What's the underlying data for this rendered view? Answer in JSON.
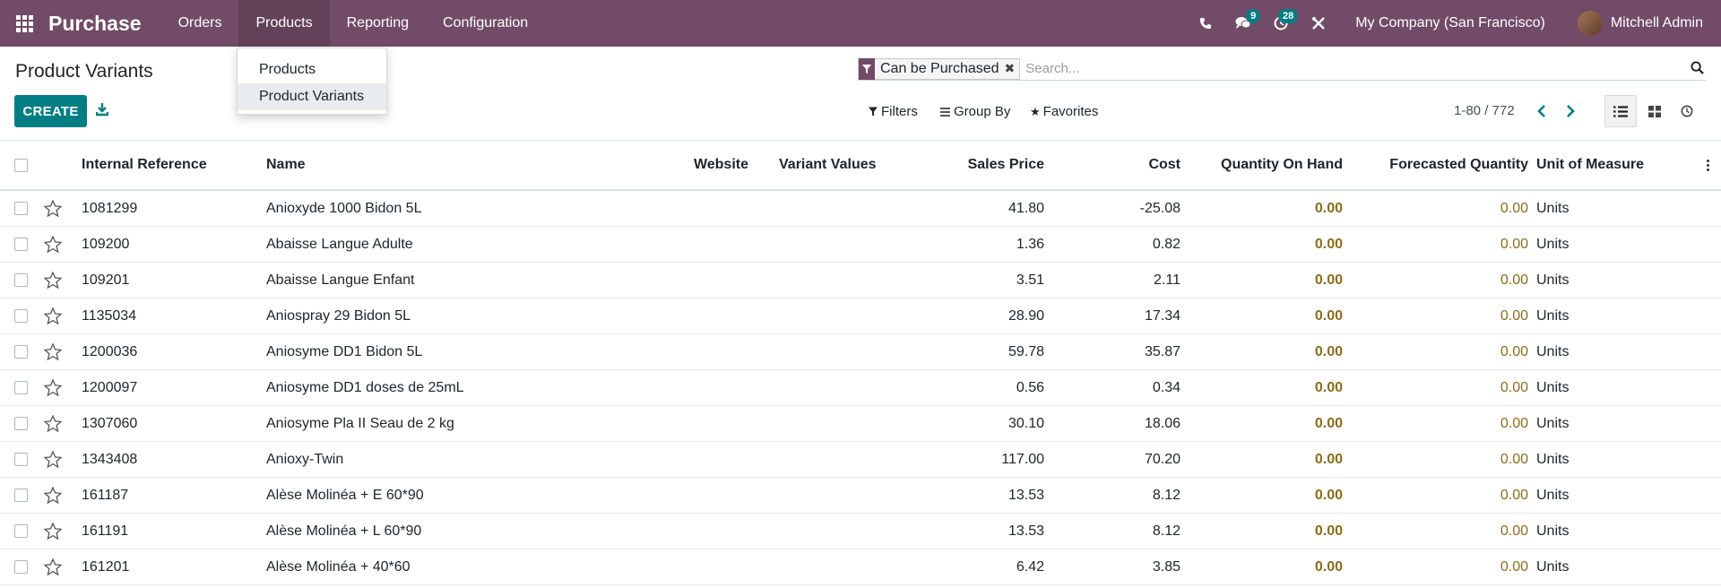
{
  "navbar": {
    "brand": "Purchase",
    "menu": [
      "Orders",
      "Products",
      "Reporting",
      "Configuration"
    ],
    "messages_count": "9",
    "activities_count": "28",
    "company": "My Company (San Francisco)",
    "user": "Mitchell Admin",
    "accent_color": "#714B67"
  },
  "products_menu": {
    "items": [
      "Products",
      "Product Variants"
    ],
    "active": "Product Variants"
  },
  "control_panel": {
    "title": "Product Variants",
    "create_label": "CREATE",
    "facet": "Can be Purchased",
    "search_placeholder": "Search...",
    "filters_label": "Filters",
    "group_by_label": "Group By",
    "favorites_label": "Favorites",
    "pager": "1-80 / 772"
  },
  "table": {
    "headers": {
      "internal_reference": "Internal Reference",
      "name": "Name",
      "website": "Website",
      "variant_values": "Variant Values",
      "sales_price": "Sales Price",
      "cost": "Cost",
      "qty_on_hand": "Quantity On Hand",
      "forecasted_qty": "Forecasted Quantity",
      "uom": "Unit of Measure"
    },
    "rows": [
      {
        "ref": "1081299",
        "name": "Anioxyde 1000 Bidon 5L",
        "price": "41.80",
        "cost": "-25.08",
        "qty": "0.00",
        "forecast": "0.00",
        "uom": "Units"
      },
      {
        "ref": "109200",
        "name": "Abaisse Langue Adulte",
        "price": "1.36",
        "cost": "0.82",
        "qty": "0.00",
        "forecast": "0.00",
        "uom": "Units"
      },
      {
        "ref": "109201",
        "name": "Abaisse Langue Enfant",
        "price": "3.51",
        "cost": "2.11",
        "qty": "0.00",
        "forecast": "0.00",
        "uom": "Units"
      },
      {
        "ref": "1135034",
        "name": "Aniospray 29 Bidon 5L",
        "price": "28.90",
        "cost": "17.34",
        "qty": "0.00",
        "forecast": "0.00",
        "uom": "Units"
      },
      {
        "ref": "1200036",
        "name": "Aniosyme DD1 Bidon 5L",
        "price": "59.78",
        "cost": "35.87",
        "qty": "0.00",
        "forecast": "0.00",
        "uom": "Units"
      },
      {
        "ref": "1200097",
        "name": "Aniosyme DD1 doses de 25mL",
        "price": "0.56",
        "cost": "0.34",
        "qty": "0.00",
        "forecast": "0.00",
        "uom": "Units"
      },
      {
        "ref": "1307060",
        "name": "Aniosyme Pla II Seau de 2 kg",
        "price": "30.10",
        "cost": "18.06",
        "qty": "0.00",
        "forecast": "0.00",
        "uom": "Units"
      },
      {
        "ref": "1343408",
        "name": "Anioxy-Twin",
        "price": "117.00",
        "cost": "70.20",
        "qty": "0.00",
        "forecast": "0.00",
        "uom": "Units"
      },
      {
        "ref": "161187",
        "name": "Alèse Molinéa + E 60*90",
        "price": "13.53",
        "cost": "8.12",
        "qty": "0.00",
        "forecast": "0.00",
        "uom": "Units"
      },
      {
        "ref": "161191",
        "name": "Alèse Molinéa + L 60*90",
        "price": "13.53",
        "cost": "8.12",
        "qty": "0.00",
        "forecast": "0.00",
        "uom": "Units"
      },
      {
        "ref": "161201",
        "name": "Alèse Molinéa + 40*60",
        "price": "6.42",
        "cost": "3.85",
        "qty": "0.00",
        "forecast": "0.00",
        "uom": "Units"
      }
    ]
  }
}
